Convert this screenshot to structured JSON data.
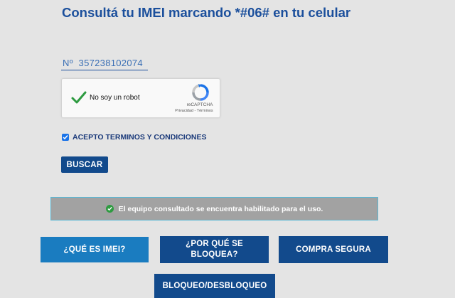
{
  "header": {
    "title": "Consultá tu IMEI marcando *#06# en tu celular"
  },
  "form": {
    "imei_value": "Nº  357238102074",
    "recaptcha": {
      "label": "No soy un robot",
      "brand": "reCAPTCHA",
      "links": "Privacidad - Términos",
      "checked": true
    },
    "terms_label": "ACEPTO TERMINOS Y CONDICIONES",
    "terms_checked": true,
    "search_button": "BUSCAR"
  },
  "status": {
    "message": "El equipo consultado se encuentra habilitado para el uso.",
    "color": "#2e9b41"
  },
  "nav": {
    "que_es_imei": "¿QUÉ ES IMEI?",
    "por_que_line1": "¿POR QUÉ SE",
    "por_que_line2": "BLOQUEA?",
    "compra_segura": "COMPRA SEGURA",
    "bloqueo": "BLOQUEO/DESBLOQUEO"
  },
  "colors": {
    "brand_blue": "#1b4f9c",
    "button_dark": "#124a8c",
    "button_light": "#1a7cc0"
  }
}
